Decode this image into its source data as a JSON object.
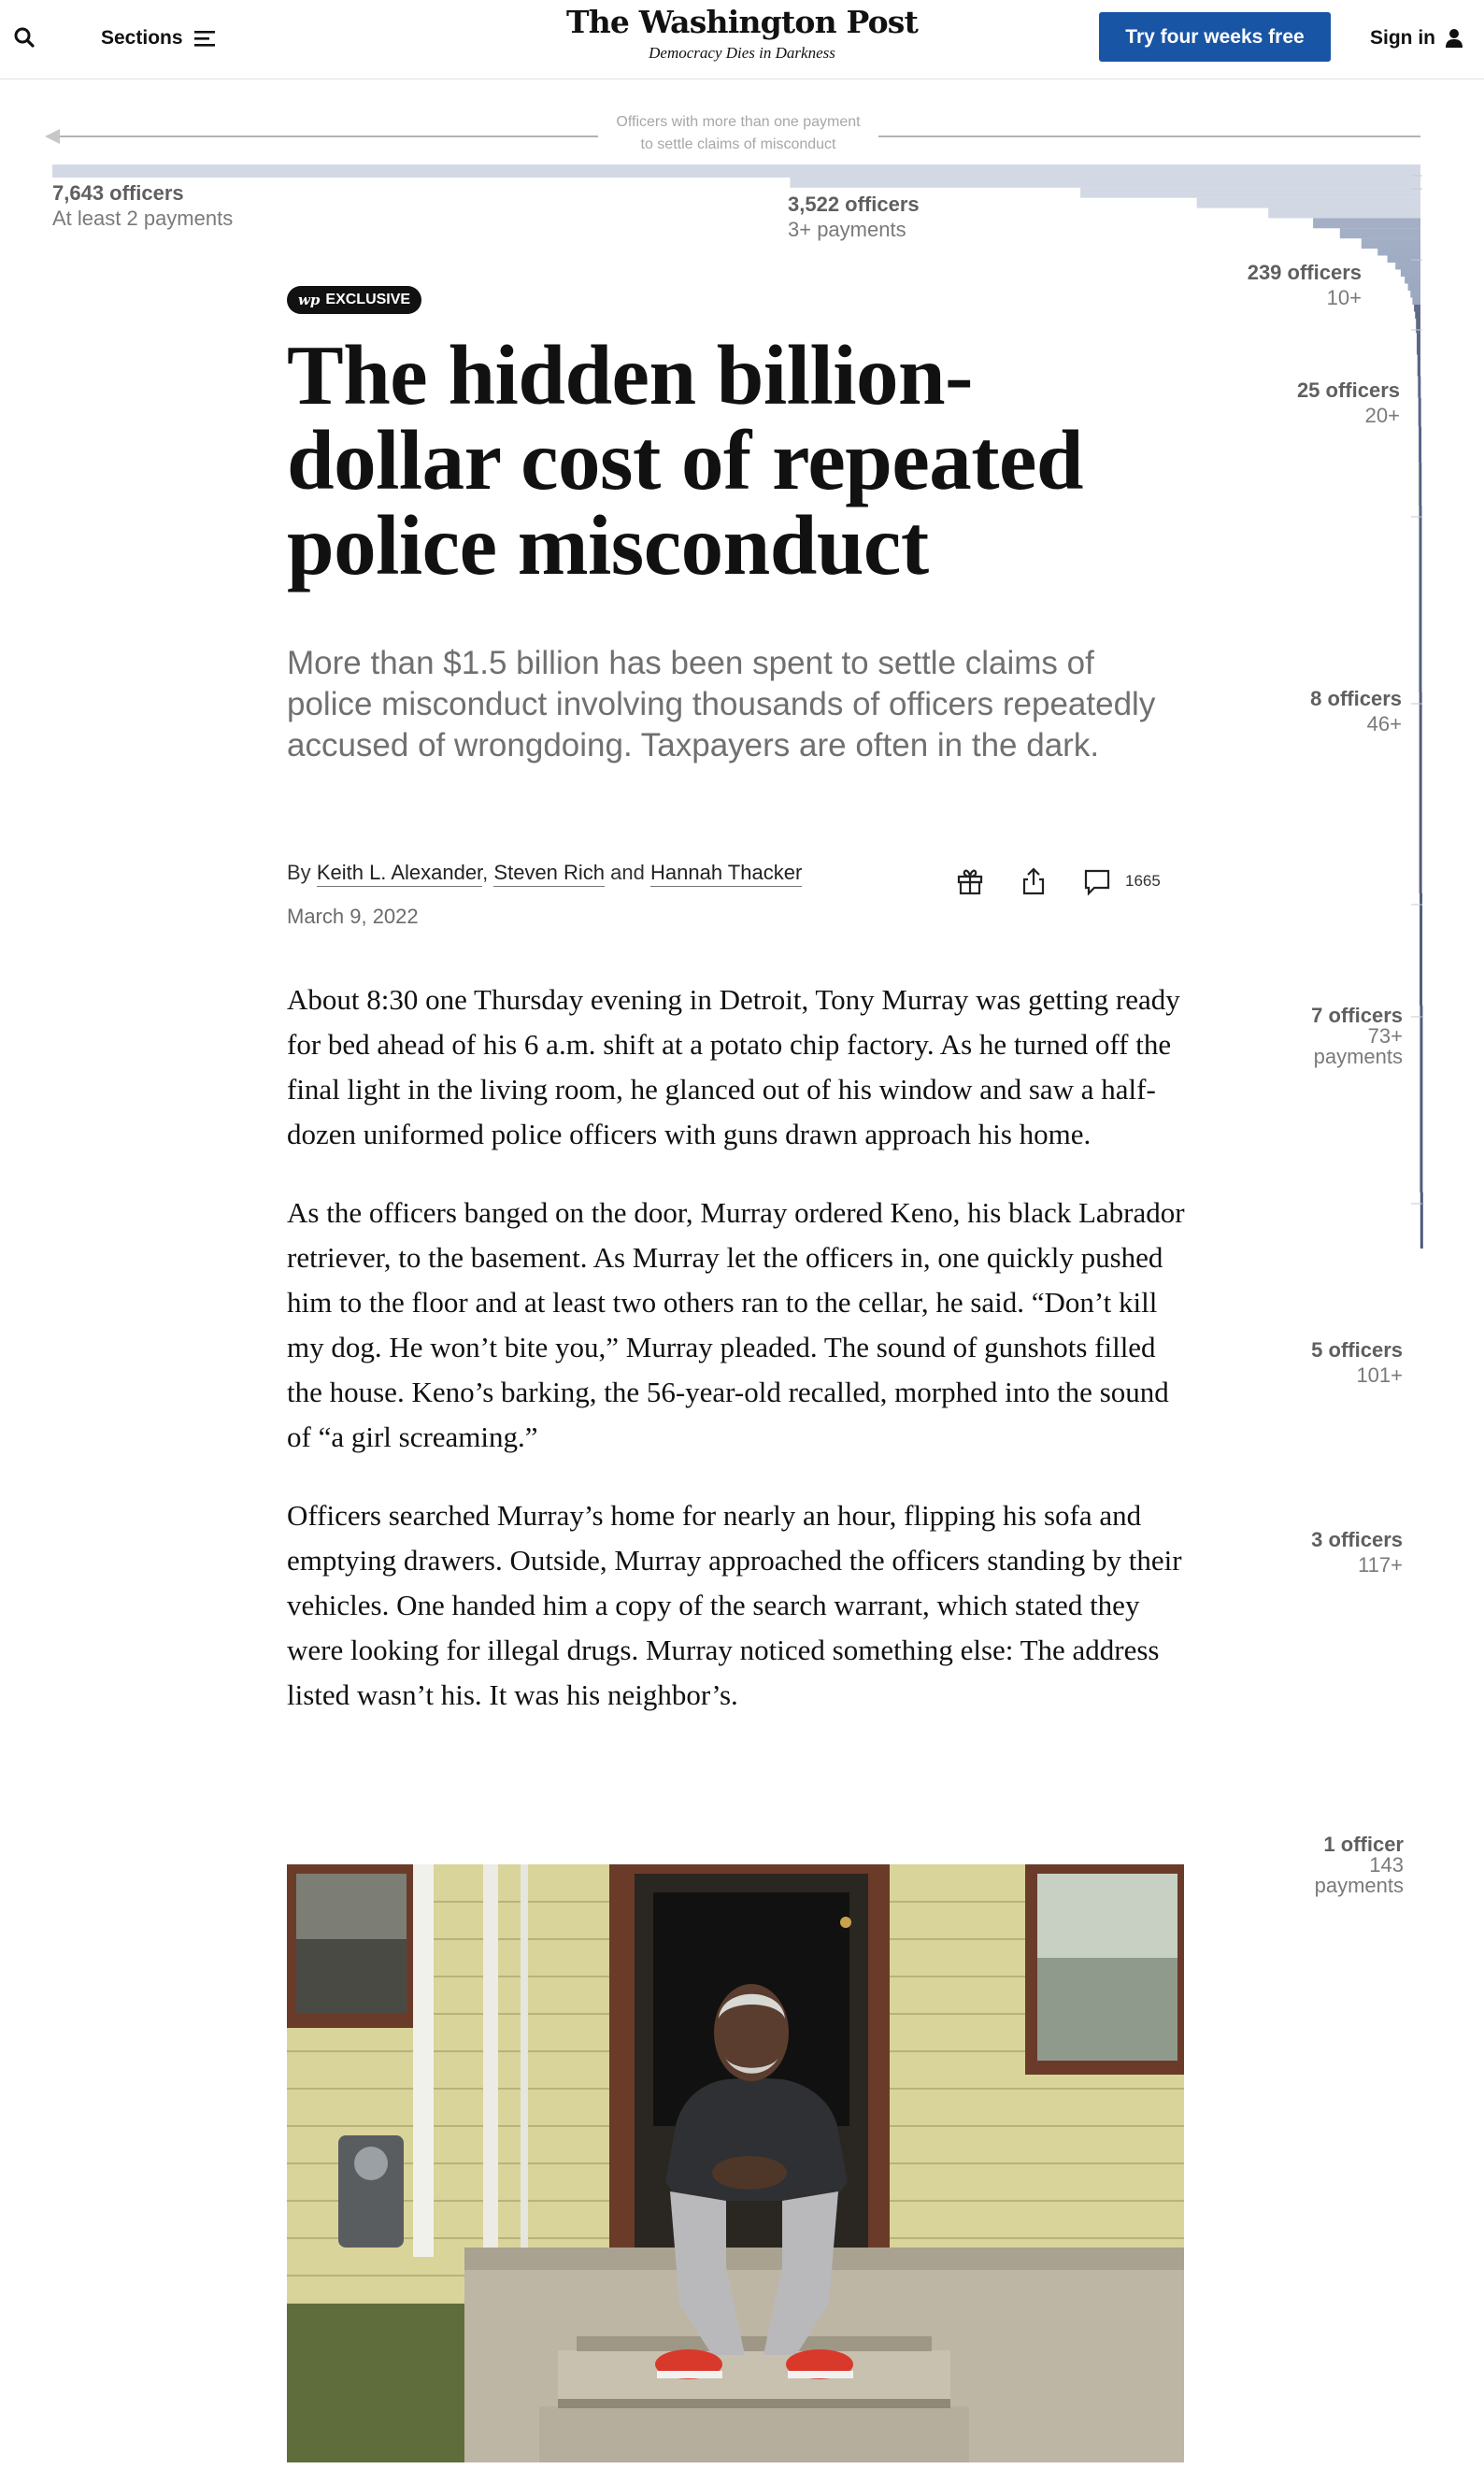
{
  "header": {
    "sections_label": "Sections",
    "logo_text": "The Washington Post",
    "tagline": "Democracy Dies in Darkness",
    "subscribe_label": "Try four weeks free",
    "signin_label": "Sign in"
  },
  "chart_data": {
    "type": "area",
    "title": "Officers with more than one payment to settle claims of misconduct",
    "title_lines": [
      "Officers with more than one payment",
      "to settle claims of misconduct"
    ],
    "xlabel": "",
    "ylabel": "",
    "x_label": "officers",
    "y_label": "payments",
    "points": [
      {
        "officers": 7643,
        "min_payments": 2,
        "count_label": "7,643 officers",
        "payments_label": "At least 2 payments"
      },
      {
        "officers": 3522,
        "min_payments": 3,
        "count_label": "3,522 officers",
        "payments_label": "3+ payments"
      },
      {
        "officers": 239,
        "min_payments": 10,
        "count_label": "239 officers",
        "payments_label": "10+"
      },
      {
        "officers": 25,
        "min_payments": 20,
        "count_label": "25 officers",
        "payments_label": "20+"
      },
      {
        "officers": 8,
        "min_payments": 46,
        "count_label": "8 officers",
        "payments_label": "46+"
      },
      {
        "officers": 7,
        "min_payments": 73,
        "count_label": "7 officers",
        "payments_label": "73+",
        "payments_label_2": "payments"
      },
      {
        "officers": 5,
        "min_payments": 101,
        "count_label": "5 officers",
        "payments_label": "101+"
      },
      {
        "officers": 3,
        "min_payments": 117,
        "count_label": "3 officers",
        "payments_label": "117+"
      },
      {
        "officers": 1,
        "min_payments": 143,
        "count_label": "1 officer",
        "payments_label": "143",
        "payments_label_2": "payments"
      }
    ],
    "steps": [
      {
        "officers": 7643,
        "min_payments": 2
      },
      {
        "officers": 3522,
        "min_payments": 3
      },
      {
        "officers": 1900,
        "min_payments": 4
      },
      {
        "officers": 1250,
        "min_payments": 5
      },
      {
        "officers": 850,
        "min_payments": 6
      },
      {
        "officers": 600,
        "min_payments": 7
      },
      {
        "officers": 450,
        "min_payments": 8
      },
      {
        "officers": 330,
        "min_payments": 9
      },
      {
        "officers": 239,
        "min_payments": 10
      },
      {
        "officers": 185,
        "min_payments": 11
      },
      {
        "officers": 140,
        "min_payments": 12
      },
      {
        "officers": 110,
        "min_payments": 13
      },
      {
        "officers": 88,
        "min_payments": 14
      },
      {
        "officers": 70,
        "min_payments": 15
      },
      {
        "officers": 56,
        "min_payments": 16
      },
      {
        "officers": 45,
        "min_payments": 17
      },
      {
        "officers": 36,
        "min_payments": 18
      },
      {
        "officers": 30,
        "min_payments": 19
      },
      {
        "officers": 25,
        "min_payments": 20
      },
      {
        "officers": 21,
        "min_payments": 22
      },
      {
        "officers": 17,
        "min_payments": 25
      },
      {
        "officers": 14,
        "min_payments": 28
      },
      {
        "officers": 12,
        "min_payments": 31
      },
      {
        "officers": 10,
        "min_payments": 35
      },
      {
        "officers": 9,
        "min_payments": 40
      },
      {
        "officers": 8,
        "min_payments": 46
      },
      {
        "officers": 7,
        "min_payments": 73
      },
      {
        "officers": 5,
        "min_payments": 101
      },
      {
        "officers": 3,
        "min_payments": 117
      },
      {
        "officers": 1,
        "min_payments": 143
      }
    ],
    "xlim": [
      0,
      7643
    ],
    "ylim": [
      2,
      143
    ],
    "colors": {
      "light": "#bcc5d6",
      "mid": "#7a8bab",
      "dark": "#2e3e64",
      "axis": "#9a9a9a"
    },
    "grid": false
  },
  "article": {
    "badge_logo": "wp",
    "badge_label": "EXCLUSIVE",
    "headline": "The hidden billion-dollar cost of repeated police misconduct",
    "dek": "More than $1.5 billion has been spent to settle claims of police misconduct involving thousands of officers repeatedly accused of wrongdoing. Taxpayers are often in the dark.",
    "byline_prefix": "By",
    "authors": [
      "Keith L. Alexander",
      "Steven Rich",
      "Hannah Thacker"
    ],
    "byline_sep": ",",
    "byline_and": "and",
    "date": "March 9, 2022",
    "comment_count": "1665",
    "paragraphs": [
      "About 8:30 one Thursday evening in Detroit, Tony Murray was getting ready for bed ahead of his 6 a.m. shift at a potato chip factory. As he turned off the final light in the living room, he glanced out of his window and saw a half-dozen uniformed police officers with guns drawn approach his home.",
      "As the officers banged on the door, Murray ordered Keno, his black Labrador retriever, to the basement. As Murray let the officers in, one quickly pushed him to the floor and at least two others ran to the cellar, he said. “Don’t kill my dog. He won’t bite you,” Murray pleaded. The sound of gunshots filled the house. Keno’s barking, the 56-year-old recalled, morphed into the sound of “a girl screaming.”",
      "Officers searched Murray’s home for nearly an hour, flipping his sofa and emptying drawers. Outside, Murray approached the officers standing by their vehicles. One handed him a copy of the search warrant, which stated they were looking for illegal drugs. Murray noticed something else: The address listed wasn’t his. It was his neighbor’s."
    ]
  }
}
